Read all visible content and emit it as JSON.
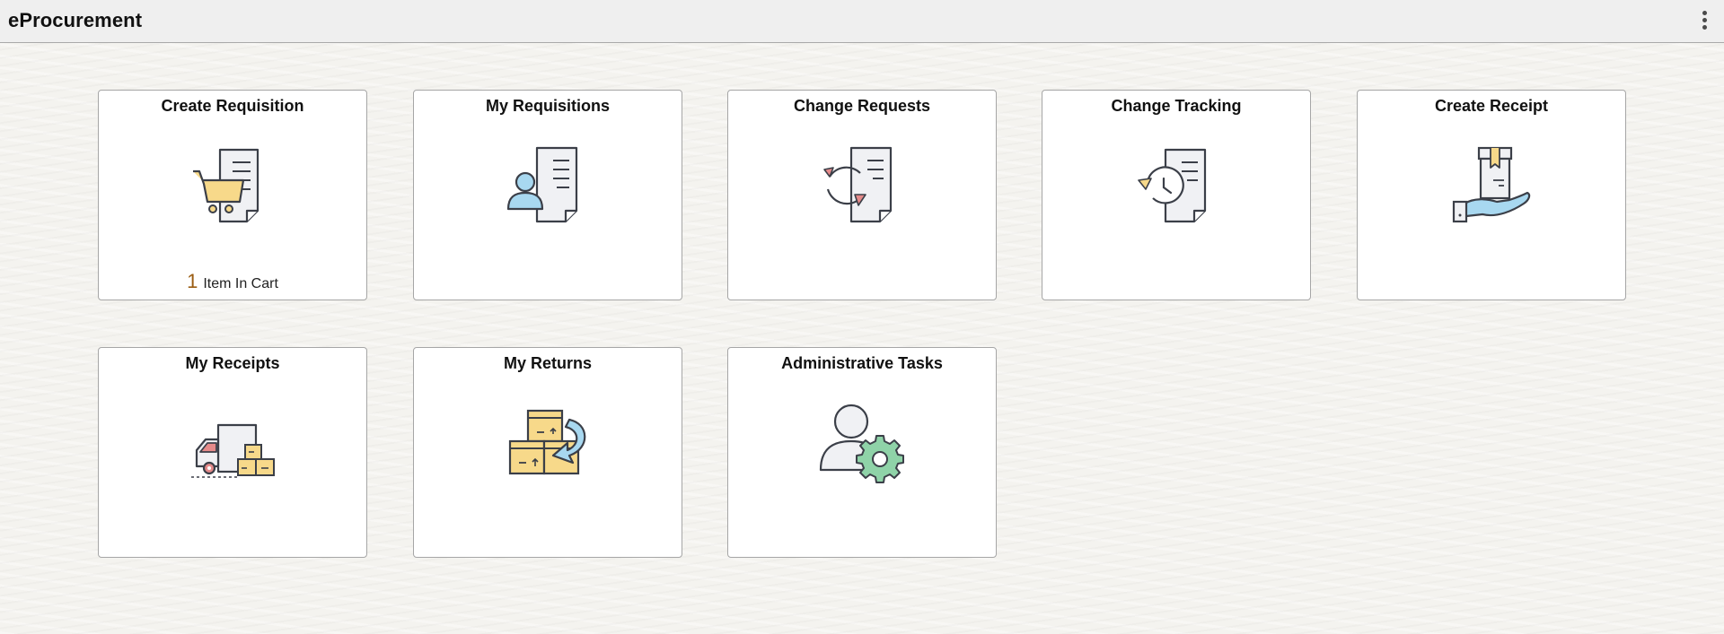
{
  "header": {
    "title": "eProcurement",
    "actions_icon": "more-vertical-icon"
  },
  "tiles": [
    {
      "title": "Create Requisition",
      "icon": "cart-document-icon",
      "count": "1",
      "count_label": "Item In Cart"
    },
    {
      "title": "My Requisitions",
      "icon": "person-document-icon"
    },
    {
      "title": "Change Requests",
      "icon": "refresh-document-icon"
    },
    {
      "title": "Change Tracking",
      "icon": "history-document-icon"
    },
    {
      "title": "Create Receipt",
      "icon": "hand-package-icon"
    },
    {
      "title": "My Receipts",
      "icon": "delivery-truck-icon"
    },
    {
      "title": "My Returns",
      "icon": "return-boxes-icon"
    },
    {
      "title": "Administrative Tasks",
      "icon": "person-gear-icon"
    }
  ],
  "colors": {
    "count_accent": "#9a5d12",
    "icon_stroke": "#3b3f48",
    "icon_paper": "#f0f1f4",
    "icon_blue": "#a8d8f0",
    "icon_yellow": "#f7d98a",
    "icon_red": "#e58a8a",
    "icon_green": "#8fd3a8"
  }
}
